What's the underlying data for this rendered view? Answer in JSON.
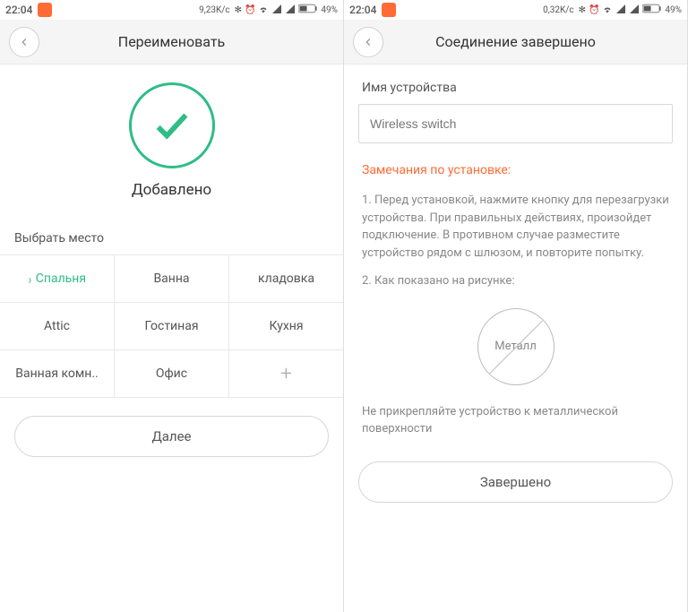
{
  "screen1": {
    "status": {
      "time": "22:04",
      "speed": "9,23K/c",
      "battery": "49%"
    },
    "header": {
      "title": "Переименовать"
    },
    "added_label": "Добавлено",
    "section_label": "Выбрать место",
    "locations": {
      "row1": [
        "Спальня",
        "Ванна",
        "кладовка"
      ],
      "row2": [
        "Attic",
        "Гостиная",
        "Кухня"
      ],
      "row3": [
        "Ванная комн..",
        "Офис",
        "+"
      ]
    },
    "selected_location": "Спальня",
    "next_btn": "Далее"
  },
  "screen2": {
    "status": {
      "time": "22:04",
      "speed": "0,32K/c",
      "battery": "49%"
    },
    "header": {
      "title": "Соединение завершено"
    },
    "device_label": "Имя устройства",
    "device_value": "Wireless switch",
    "notes_header": "Замечания по установке:",
    "note1": "1. Перед установкой, нажмите кнопку для перезагрузки устройства. При правильных действиях, произойдет подключение. В противном случае разместите устройство рядом с шлюзом, и повторите попытку.",
    "note2": "2. Как показано на рисунке:",
    "metal_label": "Металл",
    "note3": "Не прикрепляйте устройство к металлической поверхности",
    "done_btn": "Завершено"
  }
}
